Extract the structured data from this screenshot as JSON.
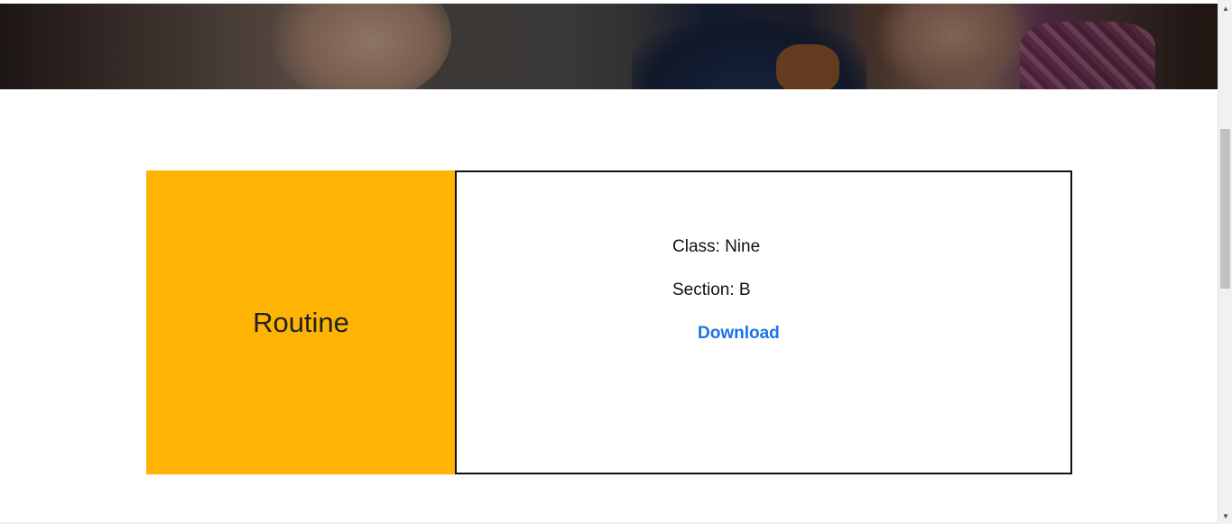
{
  "hero": {
    "alt": "students-banner"
  },
  "routine": {
    "title": "Routine",
    "class_text": "Class: Nine",
    "section_text": "Section: B",
    "download_label": "Download"
  },
  "colors": {
    "accent": "#ffb404",
    "link": "#1a73e8",
    "border": "#111111"
  },
  "scrollbar": {
    "up_icon": "▲",
    "down_icon": "▼"
  }
}
